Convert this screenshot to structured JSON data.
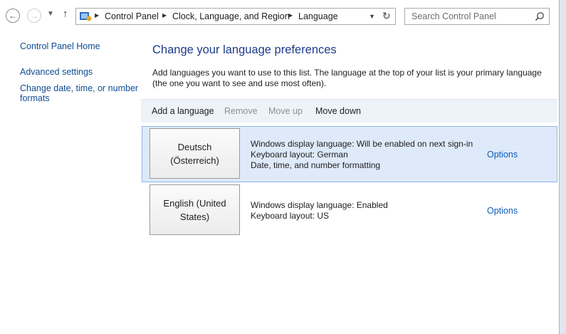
{
  "nav": {
    "back_icon": "arrow-left-icon",
    "forward_icon": "arrow-right-icon",
    "recent_icon": "chevron-down-icon",
    "up_icon": "arrow-up-icon"
  },
  "address_bar": {
    "icon": "control-panel-icon",
    "breadcrumbs": [
      "Control Panel",
      "Clock, Language, and Region",
      "Language"
    ],
    "dropdown_icon": "chevron-down-icon",
    "refresh_icon": "refresh-icon"
  },
  "search": {
    "placeholder": "Search Control Panel",
    "icon": "search-icon"
  },
  "left_pane": {
    "home_link": "Control Panel Home",
    "links": [
      "Advanced settings",
      "Change date, time, or number",
      "formats"
    ]
  },
  "main": {
    "title": "Change your language preferences",
    "intro_line1": "Add languages you want to use to this list. The language at the top of your list is your primary language",
    "intro_line2": "(the one you want to see and use most often).",
    "toolbar": {
      "add": "Add a language",
      "remove": "Remove",
      "move_up": "Move up",
      "move_down": "Move down"
    },
    "languages": [
      {
        "name_line1": "Deutsch",
        "name_line2": "(Österreich)",
        "info": [
          "Windows display language: Will be enabled on next sign-in",
          "Keyboard layout: German",
          "Date, time, and number formatting"
        ],
        "options": "Options",
        "selected": true
      },
      {
        "name_line1": "English (United",
        "name_line2": "States)",
        "info": [
          "Windows display language: Enabled",
          "Keyboard layout: US"
        ],
        "options": "Options",
        "selected": false
      }
    ]
  },
  "colors": {
    "link": "#0e4c92",
    "title": "#1e3b8a",
    "selection_bg": "#deeaf9",
    "selection_border": "#90b6e6",
    "toolbar_bg": "#eef3fa"
  }
}
